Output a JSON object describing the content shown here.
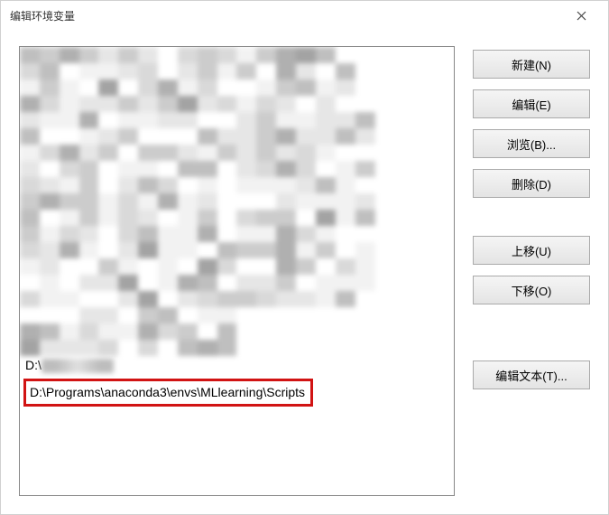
{
  "window": {
    "title": "编辑环境变量"
  },
  "list": {
    "partial_visible_prefix": "D:\\",
    "highlighted_path": "D:\\Programs\\anaconda3\\envs\\MLlearning\\Scripts"
  },
  "buttons": {
    "new": "新建(N)",
    "edit": "编辑(E)",
    "browse": "浏览(B)...",
    "delete": "删除(D)",
    "move_up": "上移(U)",
    "move_down": "下移(O)",
    "edit_text": "编辑文本(T)..."
  },
  "mosaic_palette": [
    "#ffffff",
    "#f2f2f2",
    "#e6e6e6",
    "#d9d9d9",
    "#cccccc",
    "#bfbfbf",
    "#b0b0b0",
    "#a3a3a3"
  ]
}
